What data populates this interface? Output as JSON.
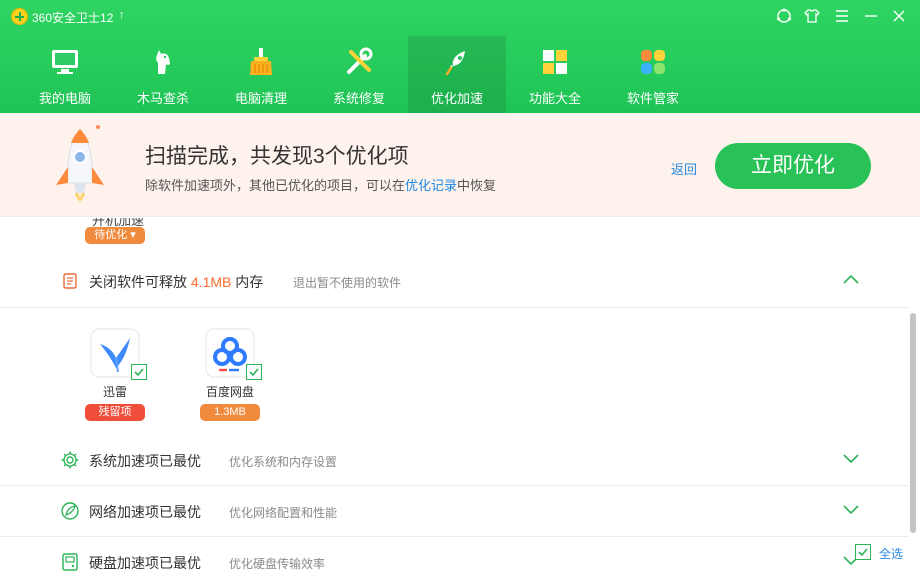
{
  "app": {
    "title": "360安全卫士12"
  },
  "window_controls": [
    "feedback-icon",
    "skin-icon",
    "menu-icon",
    "minimize-icon",
    "close-icon"
  ],
  "nav": [
    {
      "label": "我的电脑",
      "icon": "computer-icon"
    },
    {
      "label": "木马查杀",
      "icon": "horse-icon"
    },
    {
      "label": "电脑清理",
      "icon": "broom-icon"
    },
    {
      "label": "系统修复",
      "icon": "wrench-icon"
    },
    {
      "label": "优化加速",
      "icon": "rocket-icon",
      "active": true
    },
    {
      "label": "功能大全",
      "icon": "grid-icon"
    },
    {
      "label": "软件管家",
      "icon": "apps-icon"
    }
  ],
  "banner": {
    "title": "扫描完成，共发现3个优化项",
    "subtitle_pre": "除软件加速项外，其他已优化的项目，可以在",
    "subtitle_link": "优化记录",
    "subtitle_post": "中恢复",
    "back": "返回",
    "optimize_button": "立即优化"
  },
  "top_item": {
    "label": "开机加速",
    "tag": "待优化"
  },
  "sections": {
    "close_software": {
      "title_pre": "关闭软件可释放 ",
      "amount": "4.1MB",
      "title_post": " 内存",
      "desc": "退出暂不使用的软件",
      "expanded": true,
      "apps": [
        {
          "name": "迅雷",
          "tag": "残留项",
          "tag_color": "#f04e3a",
          "checked": true,
          "icon": "xunlei-icon"
        },
        {
          "name": "百度网盘",
          "tag": "1.3MB",
          "tag_color": "#f08a3c",
          "checked": true,
          "icon": "baidu-netdisk-icon"
        }
      ]
    },
    "system": {
      "title": "系统加速项已最优",
      "desc": "优化系统和内存设置"
    },
    "network": {
      "title": "网络加速项已最优",
      "desc": "优化网络配置和性能"
    },
    "disk": {
      "title": "硬盘加速项已最优",
      "desc": "优化硬盘传输效率"
    }
  },
  "select_all": {
    "label": "全选",
    "checked": true
  },
  "colors": {
    "header_green": "#29c257",
    "accent_orange": "#ff6a2e",
    "link_blue": "#1e88e5"
  }
}
